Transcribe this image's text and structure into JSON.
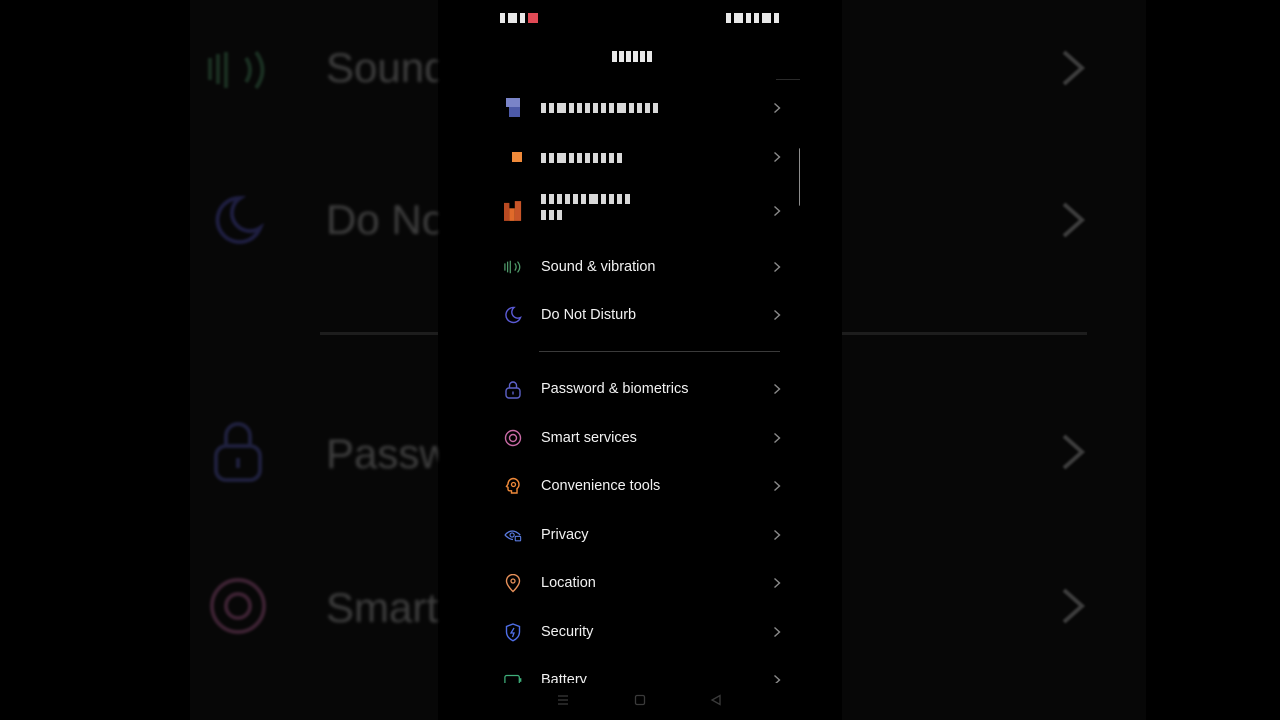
{
  "colors": {
    "background": "#000000",
    "text": "#f2f2f2",
    "chevron": "#8a8a8a",
    "sound_icon": "#4f9a6a",
    "dnd_icon": "#5b5bd6",
    "password_icon": "#5d62c9",
    "smart_icon": "#c86aa5",
    "convenience_icon": "#f08a3a",
    "privacy_icon": "#5a7be0",
    "location_icon": "#e8915a",
    "security_icon": "#4f6fe8",
    "battery_icon": "#3fae7a"
  },
  "background_preview": {
    "items": [
      {
        "label": "Sound",
        "icon": "sound-icon"
      },
      {
        "label": "Do Not Disturb",
        "icon": "moon-icon"
      },
      {
        "label": "Password & biometrics",
        "icon": "lock-icon"
      },
      {
        "label": "Smart services",
        "icon": "ring-icon"
      }
    ]
  },
  "settings": {
    "items": [
      {
        "label": "Sound & vibration",
        "icon": "sound-icon"
      },
      {
        "label": "Do Not Disturb",
        "icon": "moon-icon"
      },
      {
        "label": "Password & biometrics",
        "icon": "lock-icon"
      },
      {
        "label": "Smart services",
        "icon": "smart-services-icon"
      },
      {
        "label": "Convenience tools",
        "icon": "convenience-tools-icon"
      },
      {
        "label": "Privacy",
        "icon": "privacy-icon"
      },
      {
        "label": "Location",
        "icon": "location-pin-icon"
      },
      {
        "label": "Security",
        "icon": "shield-icon"
      },
      {
        "label": "Battery",
        "icon": "battery-icon"
      }
    ]
  },
  "navigation_bar": {
    "icons": [
      "menu-icon",
      "home-square-icon",
      "back-triangle-icon"
    ]
  }
}
